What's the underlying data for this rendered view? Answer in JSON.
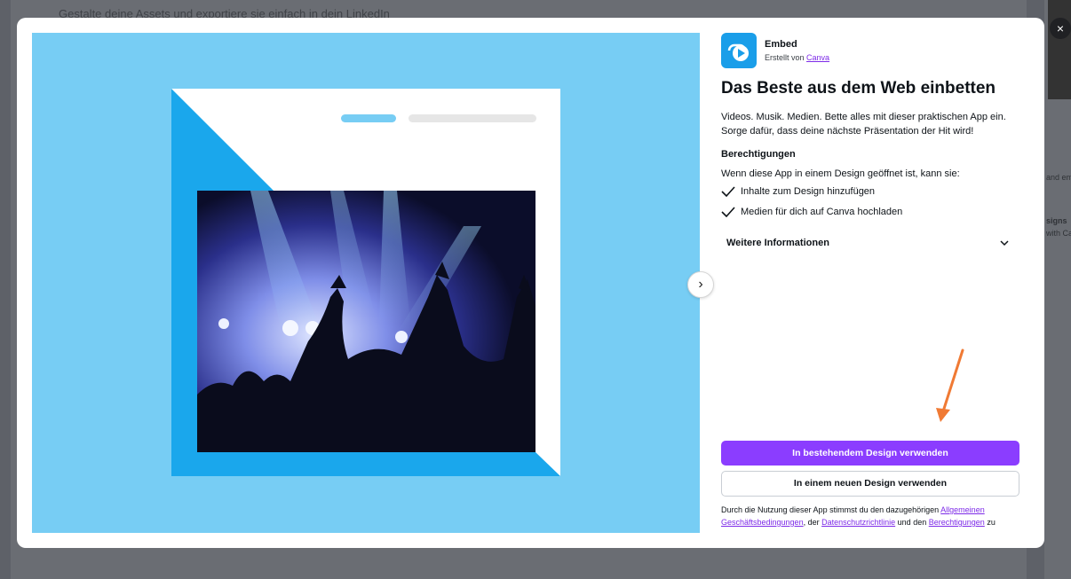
{
  "background": {
    "headline": "Gestalte deine Assets und exportiere sie einfach in dein LinkedIn",
    "side_snippets": [
      "and em",
      "signs",
      "with Can"
    ]
  },
  "close_icon": "×",
  "preview": {
    "next_icon": "›",
    "colors": {
      "bg": "#77cdf4",
      "accent": "#1aa7ec"
    }
  },
  "app": {
    "name": "Embed",
    "created_by_prefix": "Erstellt von",
    "created_by_link": "Canva",
    "icon": "embed-app-icon"
  },
  "info": {
    "title": "Das Beste aus dem Web einbetten",
    "description": "Videos. Musik. Medien. Bette alles mit dieser praktischen App ein. Sorge dafür, dass deine nächste Präsentation der Hit wird!",
    "permissions_heading": "Berechtigungen",
    "permissions_intro": "Wenn diese App in einem Design geöffnet ist, kann sie:",
    "permissions": [
      "Inhalte zum Design hinzufügen",
      "Medien für dich auf Canva hochladen"
    ],
    "more_info_label": "Weitere Informationen"
  },
  "actions": {
    "primary_label": "In bestehendem Design verwenden",
    "secondary_label": "In einem neuen Design verwenden",
    "primary_color": "#8b3dff"
  },
  "terms": {
    "prefix": "Durch die Nutzung dieser App stimmst du den dazugehörigen",
    "link1": "Allgemeinen Geschäftsbedingungen",
    "mid1": ", der",
    "link2": "Datenschutzrichtlinie",
    "mid2": "und den",
    "link3": "Berechtigungen",
    "suffix": "zu"
  }
}
